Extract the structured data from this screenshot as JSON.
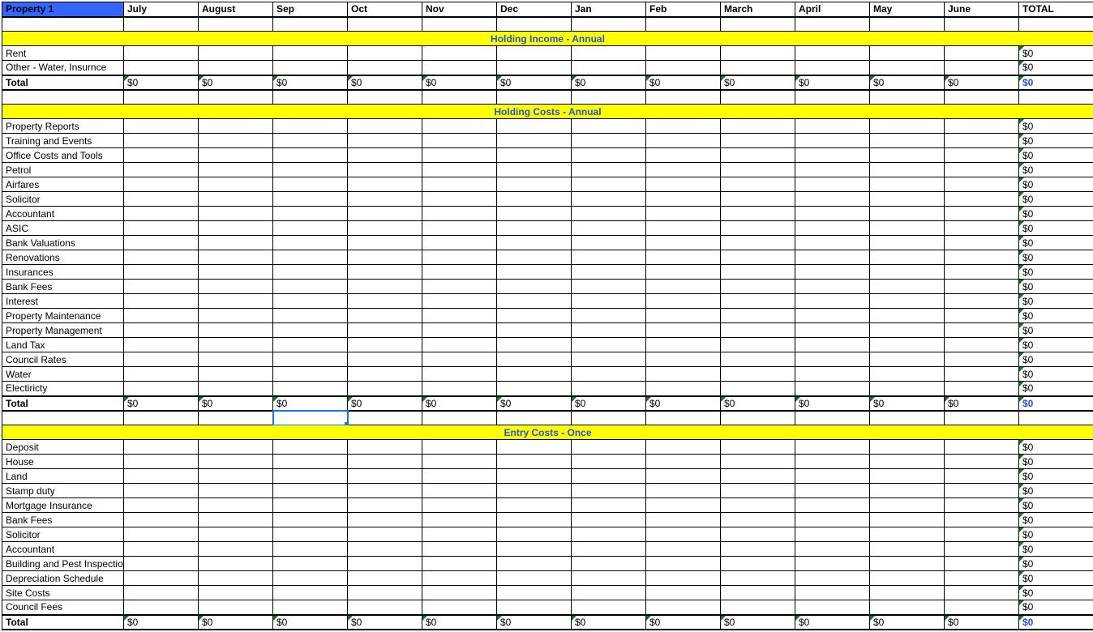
{
  "header": {
    "property": "Property 1",
    "months": [
      "July",
      "August",
      "Sep",
      "Oct",
      "Nov",
      "Dec",
      "Jan",
      "Feb",
      "March",
      "April",
      "May",
      "June"
    ],
    "total": "TOTAL"
  },
  "sections": [
    {
      "title": "Holding Income - Annual",
      "rows": [
        {
          "label": "Rent",
          "total": "$0"
        },
        {
          "label": "Other - Water, Insurnce",
          "total": "$0"
        }
      ],
      "total_row": {
        "label": "Total",
        "months": [
          "$0",
          "$0",
          "$0",
          "$0",
          "$0",
          "$0",
          "$0",
          "$0",
          "$0",
          "$0",
          "$0",
          "$0"
        ],
        "total": "$0"
      }
    },
    {
      "title": "Holding Costs - Annual",
      "rows": [
        {
          "label": "Property Reports",
          "total": "$0"
        },
        {
          "label": "Training and Events",
          "total": "$0"
        },
        {
          "label": "Office Costs and Tools",
          "total": "$0"
        },
        {
          "label": "Petrol",
          "total": "$0"
        },
        {
          "label": "Airfares",
          "total": "$0"
        },
        {
          "label": "Solicitor",
          "total": "$0"
        },
        {
          "label": "Accountant",
          "total": "$0"
        },
        {
          "label": "ASIC",
          "total": "$0"
        },
        {
          "label": "Bank Valuations",
          "total": "$0"
        },
        {
          "label": "Renovations",
          "total": "$0"
        },
        {
          "label": "Insurances",
          "total": "$0"
        },
        {
          "label": "Bank Fees",
          "total": "$0"
        },
        {
          "label": "Interest",
          "total": "$0"
        },
        {
          "label": "Property Maintenance",
          "total": "$0"
        },
        {
          "label": "Property Management",
          "total": "$0"
        },
        {
          "label": "Land Tax",
          "total": "$0"
        },
        {
          "label": "Council Rates",
          "total": "$0"
        },
        {
          "label": "Water",
          "total": "$0"
        },
        {
          "label": "Electiricty",
          "total": "$0"
        }
      ],
      "total_row": {
        "label": "Total",
        "months": [
          "$0",
          "$0",
          "$0",
          "$0",
          "$0",
          "$0",
          "$0",
          "$0",
          "$0",
          "$0",
          "$0",
          "$0"
        ],
        "total": "$0"
      },
      "selected_col": 2
    },
    {
      "title": "Entry Costs - Once",
      "rows": [
        {
          "label": "Deposit",
          "total": "$0"
        },
        {
          "label": "House",
          "total": "$0"
        },
        {
          "label": "Land",
          "total": "$0"
        },
        {
          "label": "Stamp duty",
          "total": "$0"
        },
        {
          "label": "Mortgage Insurance",
          "total": "$0"
        },
        {
          "label": "Bank Fees",
          "total": "$0"
        },
        {
          "label": "Solicitor",
          "total": "$0"
        },
        {
          "label": "Accountant",
          "total": "$0"
        },
        {
          "label": "Building and Pest Inspection",
          "total": "$0"
        },
        {
          "label": "Depreciation Schedule",
          "total": "$0"
        },
        {
          "label": "Site Costs",
          "total": "$0"
        },
        {
          "label": "Council Fees",
          "total": "$0"
        }
      ],
      "total_row": {
        "label": "Total",
        "months": [
          "$0",
          "$0",
          "$0",
          "$0",
          "$0",
          "$0",
          "$0",
          "$0",
          "$0",
          "$0",
          "$0",
          "$0"
        ],
        "total": "$0"
      }
    }
  ]
}
